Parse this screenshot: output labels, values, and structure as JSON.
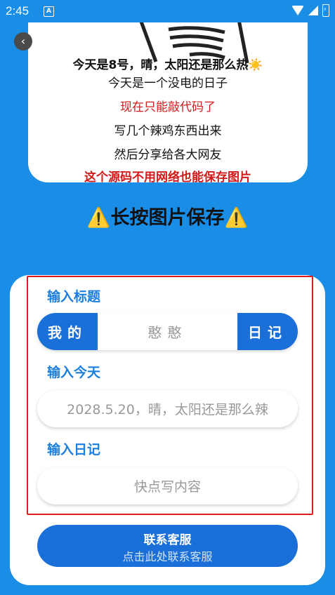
{
  "statusbar": {
    "time": "2:45",
    "app_icon": "A"
  },
  "card": {
    "lines": [
      "今天是8号，晴，太阳还是那么热☀️",
      "今天是一个没电的日子",
      "现在只能敲代码了",
      "写几个辣鸡东西出来",
      "然后分享给各大网友",
      "这个源码不用网络也能保存图片"
    ]
  },
  "back_icon": "‹",
  "save_hint": "⚠️长按图片保存⚠️",
  "form": {
    "title_label": "输入标题",
    "title_left": "我的",
    "title_value": "憨憨",
    "title_right": "日记",
    "today_label": "输入今天",
    "today_value": "2028.5.20，晴，太阳还是那么辣",
    "diary_label": "输入日记",
    "diary_placeholder": "快点写内容"
  },
  "contact": {
    "title": "联系客服",
    "subtitle": "点击此处联系客服"
  },
  "colors": {
    "background": "#1a8ee6",
    "accent": "#1a6fd8",
    "red": "#d21a1a"
  }
}
